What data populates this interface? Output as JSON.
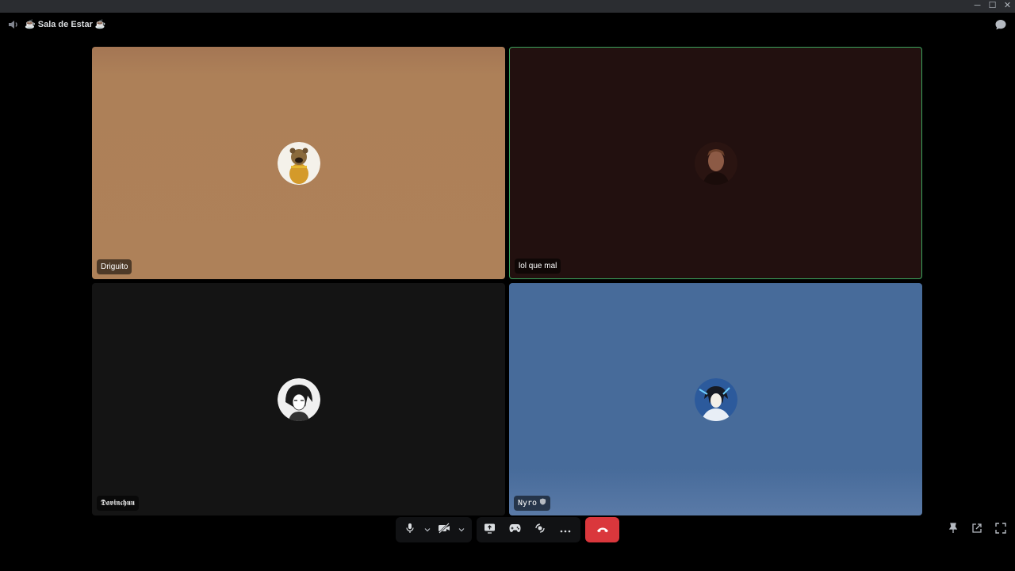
{
  "window": {
    "controls": [
      {
        "name": "minimize-button",
        "glyph": "─"
      },
      {
        "name": "maximize-button",
        "glyph": "☐"
      },
      {
        "name": "close-button",
        "glyph": "✕"
      }
    ]
  },
  "header": {
    "channel_name": "☕ Sala de Estar ☕",
    "channel_icon": "speaker-icon",
    "chat_icon": "chat-bubble-icon"
  },
  "participants": [
    {
      "name": "Driguito",
      "tile_color": "#ae8159",
      "avatar": "bear-avatar",
      "speaking": false
    },
    {
      "name": "lol que mal",
      "tile_color": "#22100f",
      "avatar": "man-portrait-avatar",
      "speaking": true,
      "highlight_color": "#3ba55d"
    },
    {
      "name": "𝕯𝖆𝖛𝖎𝖓𝖈𝖍𝖚𝖚",
      "tile_color": "#141414",
      "avatar": "manga-character-avatar",
      "speaking": false
    },
    {
      "name": "Nyro",
      "badge_icon": "shield-badge-icon",
      "tile_color": "#476b9a",
      "avatar": "anime-character-avatar",
      "speaking": false
    }
  ],
  "controls": {
    "hangup_color": "#da373c",
    "buttons": [
      "microphone-icon",
      "camera-off-icon",
      "screen-share-icon",
      "activities-icon",
      "soundboard-icon",
      "more-icon",
      "hang-up-icon"
    ],
    "right": [
      "pin-icon",
      "pop-out-icon",
      "fullscreen-icon"
    ]
  }
}
